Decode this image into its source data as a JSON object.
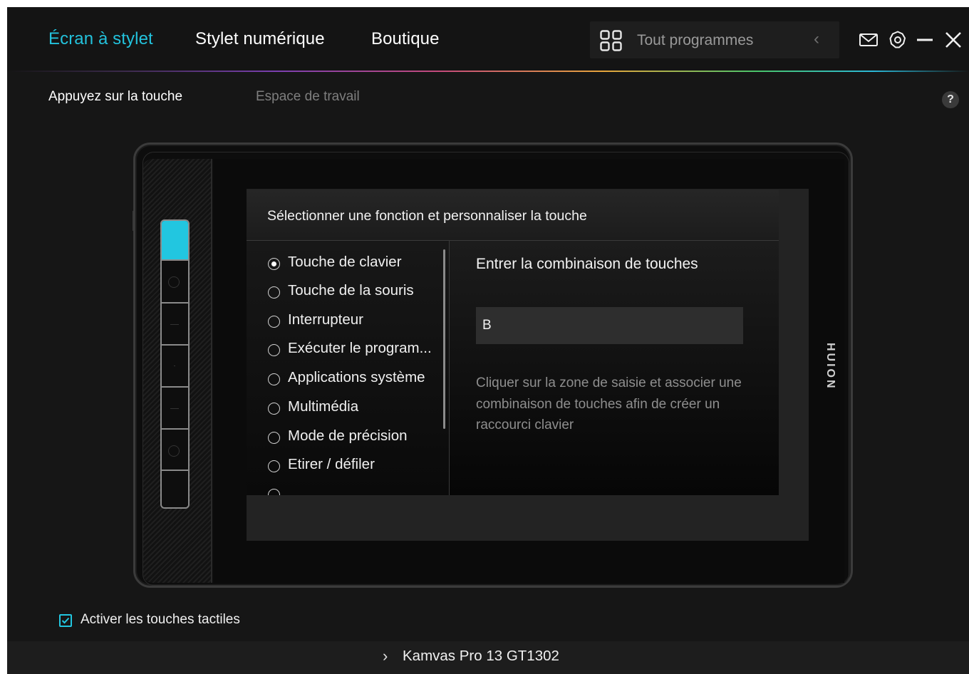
{
  "header": {
    "nav_tabs": [
      {
        "label": "Écran à stylet",
        "active": true
      },
      {
        "label": "Stylet numérique",
        "active": false
      },
      {
        "label": "Boutique",
        "active": false
      }
    ],
    "program_selector": {
      "label": "Tout programmes",
      "icon": "grid-icon",
      "chevron": "chevron-left-icon"
    },
    "icons": [
      "mail-icon",
      "settings-icon",
      "minimize-icon",
      "close-icon"
    ]
  },
  "subtabs": [
    {
      "label": "Appuyez sur la touche",
      "active": true
    },
    {
      "label": "Espace de travail",
      "active": false
    }
  ],
  "help_label": "?",
  "device": {
    "brand": "HUION",
    "express_keys": [
      {
        "active": true
      },
      {
        "active": false
      },
      {
        "active": false
      },
      {
        "active": false
      },
      {
        "active": false
      },
      {
        "active": false
      },
      {
        "active": false
      }
    ]
  },
  "dialog": {
    "title": "Sélectionner une fonction et personnaliser la touche",
    "functions": [
      {
        "label": "Touche de clavier",
        "selected": true
      },
      {
        "label": "Touche de la souris",
        "selected": false
      },
      {
        "label": "Interrupteur",
        "selected": false
      },
      {
        "label": "Exécuter le program...",
        "selected": false
      },
      {
        "label": "Applications système",
        "selected": false
      },
      {
        "label": "Multimédia",
        "selected": false
      },
      {
        "label": "Mode de précision",
        "selected": false
      },
      {
        "label": "Etirer / défiler",
        "selected": false
      }
    ],
    "detail": {
      "heading": "Entrer la combinaison de touches",
      "input_value": "B",
      "hint": "Cliquer sur la zone de saisie et associer une combinaison de touches afin de créer un raccourci clavier"
    }
  },
  "footer": {
    "enable_touch_label": "Activer les touches tactiles",
    "enable_touch_checked": true,
    "device_name": "Kamvas Pro 13 GT1302"
  },
  "colors": {
    "accent": "#22c6e0",
    "background": "#161616",
    "text_muted": "#8e8e8e"
  }
}
